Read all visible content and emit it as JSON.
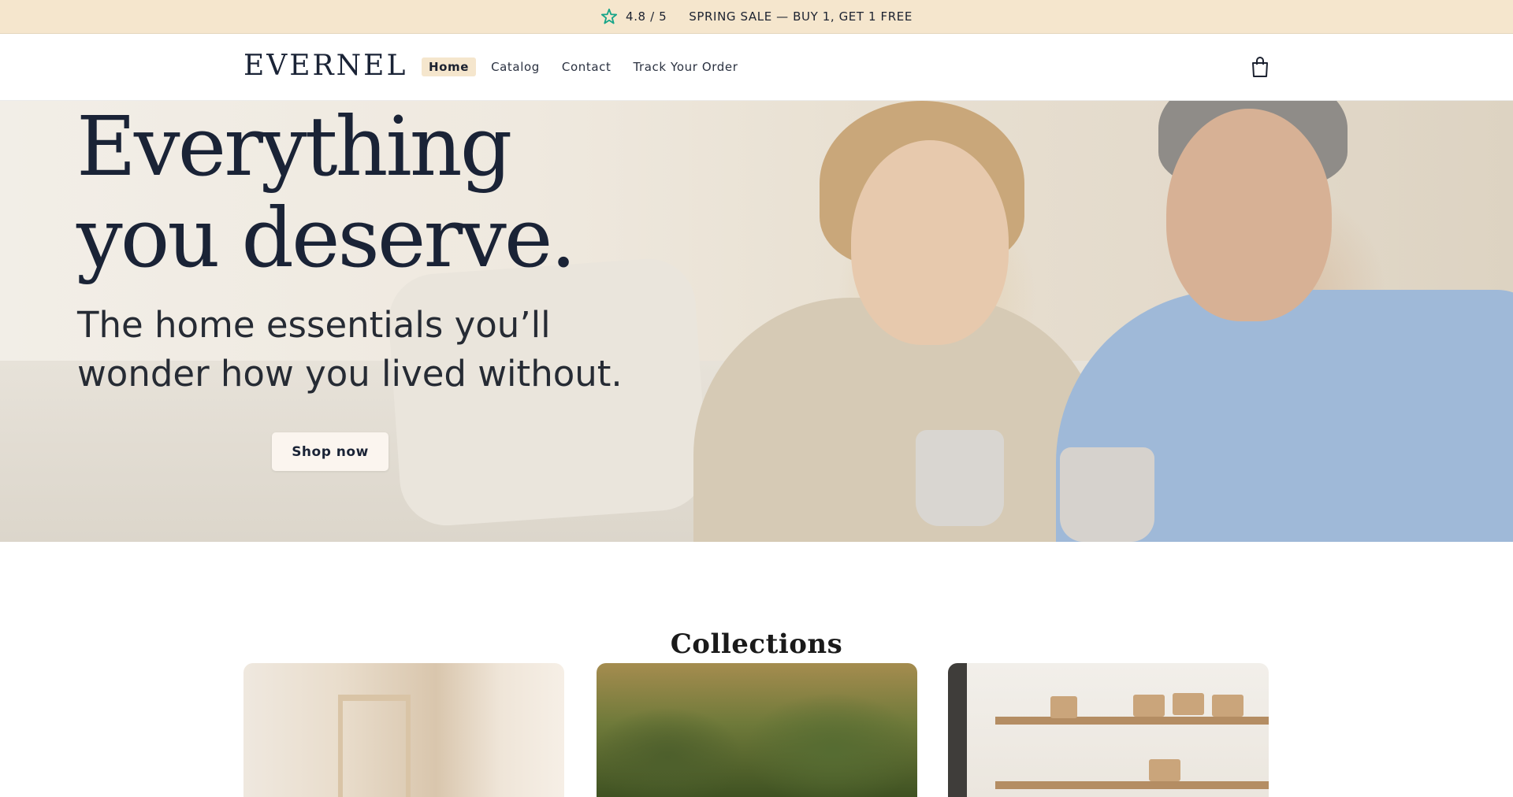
{
  "announcement": {
    "rating_icon": "star-icon",
    "rating": "4.8 / 5",
    "sale_text": "SPRING SALE — BUY 1, GET 1 FREE"
  },
  "header": {
    "logo": "EVERNEL",
    "nav": [
      {
        "label": "Home",
        "active": true
      },
      {
        "label": "Catalog",
        "active": false
      },
      {
        "label": "Contact",
        "active": false
      },
      {
        "label": "Track Your Order",
        "active": false
      }
    ],
    "cart_icon": "shopping-bag-icon"
  },
  "hero": {
    "title_line1": "Everything",
    "title_line2": "you deserve.",
    "subtitle_line1": "The home essentials you’ll",
    "subtitle_line2": "wonder how you lived without.",
    "cta_label": "Shop now"
  },
  "collections": {
    "title": "Collections"
  },
  "colors": {
    "announcement_bg": "#f5e6cd",
    "star": "#17a589",
    "text_dark": "#1a2336"
  }
}
